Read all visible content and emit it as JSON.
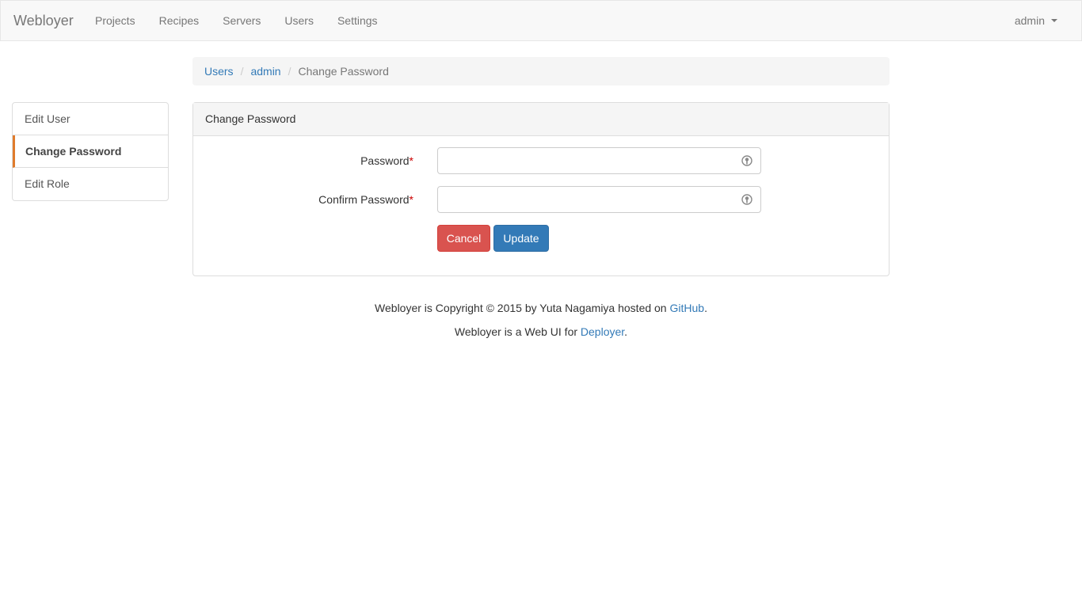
{
  "navbar": {
    "brand": "Webloyer",
    "items": [
      {
        "label": "Projects"
      },
      {
        "label": "Recipes"
      },
      {
        "label": "Servers"
      },
      {
        "label": "Users"
      },
      {
        "label": "Settings"
      }
    ],
    "user_menu": "admin"
  },
  "breadcrumb": {
    "items": [
      "Users",
      "admin"
    ],
    "separator": "/",
    "current": "Change Password"
  },
  "sidebar": {
    "items": [
      {
        "label": "Edit User"
      },
      {
        "label": "Change Password"
      },
      {
        "label": "Edit Role"
      }
    ],
    "active_index": 1,
    "active_accent": "#e07b2c"
  },
  "panel": {
    "title": "Change Password",
    "fields": [
      {
        "label": "Password",
        "required_mark": "*",
        "value": "",
        "icon": "key-icon"
      },
      {
        "label": "Confirm Password",
        "required_mark": "*",
        "value": "",
        "icon": "key-icon"
      }
    ],
    "cancel_label": "Cancel",
    "update_label": "Update"
  },
  "footer": {
    "line1_prefix": "Webloyer is Copyright © 2015 by Yuta Nagamiya hosted on ",
    "line1_link": "GitHub",
    "line1_suffix": ".",
    "line2_prefix": "Webloyer is a Web UI for ",
    "line2_link": "Deployer",
    "line2_suffix": "."
  },
  "colors": {
    "link": "#337ab7",
    "danger": "#d9534f",
    "primary": "#337ab7",
    "required": "#cc0000"
  }
}
